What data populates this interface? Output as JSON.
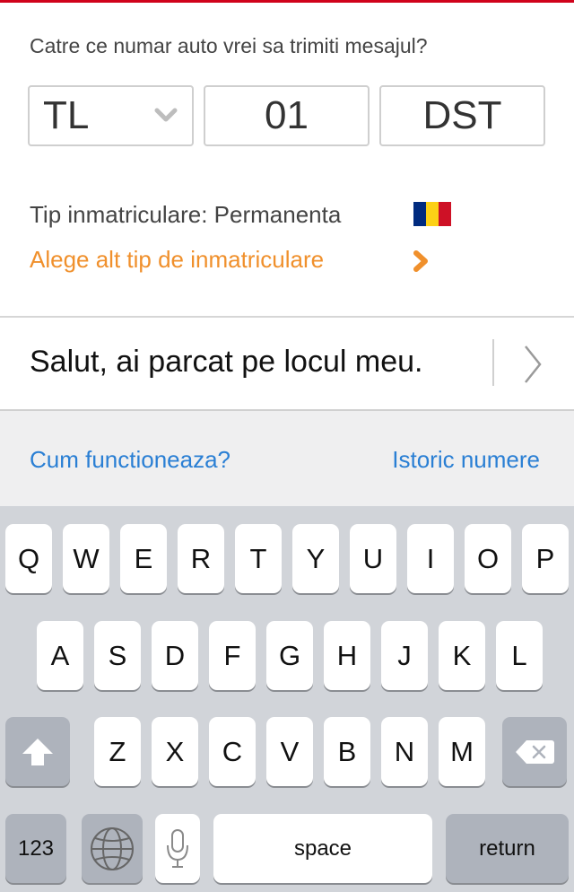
{
  "prompt": "Catre ce numar auto vrei sa trimiti mesajul?",
  "plate": {
    "county": "TL",
    "number": "01",
    "letters": "DST"
  },
  "registration": {
    "type_label": "Tip inmatriculare: Permanenta",
    "change_link": "Alege alt tip de inmatriculare",
    "flag_colors": [
      "#002b7f",
      "#fcd116",
      "#ce1126"
    ]
  },
  "message": {
    "text": "Salut, ai parcat pe locul meu."
  },
  "links": {
    "how_it_works": "Cum functioneaza?",
    "history": "Istoric numere"
  },
  "keyboard": {
    "row1": [
      "Q",
      "W",
      "E",
      "R",
      "T",
      "Y",
      "U",
      "I",
      "O",
      "P"
    ],
    "row2": [
      "A",
      "S",
      "D",
      "F",
      "G",
      "H",
      "J",
      "K",
      "L"
    ],
    "row3": [
      "Z",
      "X",
      "C",
      "V",
      "B",
      "N",
      "M"
    ],
    "numbers_label": "123",
    "space_label": "space",
    "return_label": "return",
    "shift_icon": "shift-arrow",
    "delete_icon": "backspace",
    "globe_icon": "globe",
    "mic_icon": "microphone"
  },
  "colors": {
    "accent_red": "#d0021b",
    "link_blue": "#2a7fd4",
    "link_orange": "#f0902c"
  }
}
